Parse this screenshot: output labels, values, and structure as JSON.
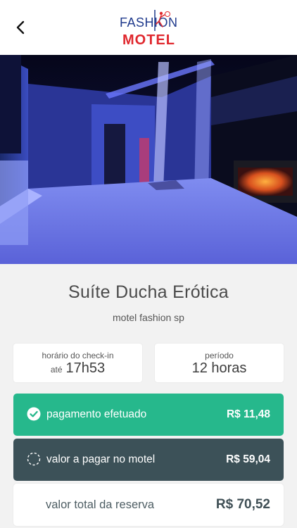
{
  "header": {
    "logo_top": "FASHION",
    "logo_bottom": "MOTEL"
  },
  "suite": {
    "name": "Suíte Ducha Erótica",
    "motel": "motel fashion sp"
  },
  "checkin": {
    "label": "horário do check-in",
    "prefix": "até",
    "time": "17h53"
  },
  "period": {
    "label": "período",
    "value": "12 horas"
  },
  "payments": {
    "paid_label": "pagamento efetuado",
    "paid_amount": "R$ 11,48",
    "due_label": "valor a pagar no motel",
    "due_amount": "R$ 59,04",
    "total_label": "valor total da reserva",
    "total_amount": "R$ 70,52"
  },
  "colors": {
    "paid": "#26b88c",
    "due": "#3c5158",
    "logo_blue": "#1f3a8c",
    "logo_red": "#e0282e"
  },
  "icons": {
    "back": "chevron-left-icon",
    "paid": "check-circle-icon",
    "due": "dashed-circle-icon"
  }
}
